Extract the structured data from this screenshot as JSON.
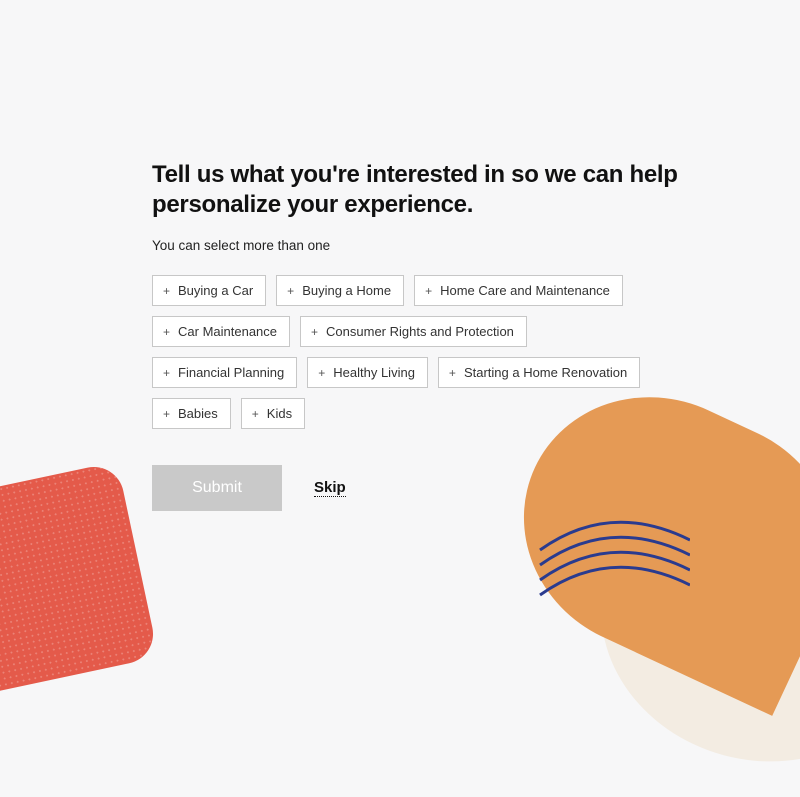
{
  "heading": "Tell us what you're interested in so we can help personalize your experience.",
  "subtitle": "You can select more than one",
  "interests": [
    {
      "label": "Buying a Car"
    },
    {
      "label": "Buying a Home"
    },
    {
      "label": "Home Care and Maintenance"
    },
    {
      "label": "Car Maintenance"
    },
    {
      "label": "Consumer Rights and Protection"
    },
    {
      "label": "Financial Planning"
    },
    {
      "label": "Healthy Living"
    },
    {
      "label": "Starting a Home Renovation"
    },
    {
      "label": "Babies"
    },
    {
      "label": "Kids"
    }
  ],
  "actions": {
    "submit_label": "Submit",
    "skip_label": "Skip"
  }
}
